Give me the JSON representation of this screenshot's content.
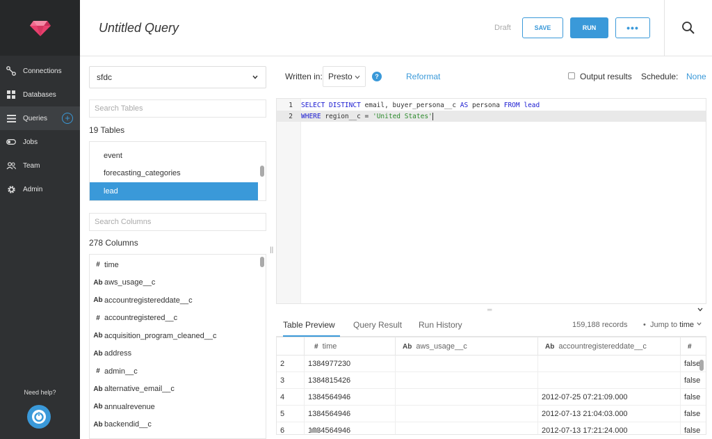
{
  "header": {
    "title": "Untitled Query",
    "draft": "Draft",
    "save_label": "SAVE",
    "run_label": "RUN",
    "more_label": "•••"
  },
  "sidebar": {
    "items": [
      {
        "label": "Connections",
        "icon": "connections-icon"
      },
      {
        "label": "Databases",
        "icon": "databases-icon"
      },
      {
        "label": "Queries",
        "icon": "queries-icon"
      },
      {
        "label": "Jobs",
        "icon": "jobs-icon"
      },
      {
        "label": "Team",
        "icon": "team-icon"
      },
      {
        "label": "Admin",
        "icon": "gear-icon"
      }
    ],
    "active": "Queries",
    "help_label": "Need help?"
  },
  "left": {
    "database": "sfdc",
    "search_tables_placeholder": "Search Tables",
    "tables_count": "19 Tables",
    "tables": [
      "event",
      "forecasting_categories",
      "lead"
    ],
    "selected_table": "lead",
    "search_columns_placeholder": "Search Columns",
    "columns_count": "278 Columns",
    "columns": [
      {
        "type": "#",
        "name": "time"
      },
      {
        "type": "Ab",
        "name": "aws_usage__c"
      },
      {
        "type": "Ab",
        "name": "accountregistereddate__c"
      },
      {
        "type": "#",
        "name": "accountregistered__c"
      },
      {
        "type": "Ab",
        "name": "acquisition_program_cleaned__c"
      },
      {
        "type": "Ab",
        "name": "address"
      },
      {
        "type": "#",
        "name": "admin__c"
      },
      {
        "type": "Ab",
        "name": "alternative_email__c"
      },
      {
        "type": "Ab",
        "name": "annualrevenue"
      },
      {
        "type": "Ab",
        "name": "backendid__c"
      }
    ]
  },
  "toolbar": {
    "written_in": "Written in:",
    "language": "Presto",
    "help": "?",
    "reformat": "Reformat",
    "output_results": "Output results",
    "schedule": "Schedule:",
    "schedule_value": "None"
  },
  "editor": {
    "lines": [
      {
        "num": "1",
        "kw1": "SELECT DISTINCT",
        "t1": " email, buyer_persona__c ",
        "kw2": "AS",
        "t2": " persona ",
        "kw3": "FROM",
        "t3": " ",
        "kw4": "lead"
      },
      {
        "num": "2",
        "kw1": "WHERE",
        "t1": " region__c = ",
        "str": "'United States'"
      }
    ]
  },
  "results": {
    "tabs": [
      "Table Preview",
      "Query Result",
      "Run History"
    ],
    "active_tab": "Table Preview",
    "records": "159,188 records",
    "bullet": "•",
    "jump_to": "Jump to",
    "jump_field": "time",
    "columns": [
      {
        "type": "#",
        "name": "time"
      },
      {
        "type": "Ab",
        "name": "aws_usage__c"
      },
      {
        "type": "Ab",
        "name": "accountregistereddate__c"
      },
      {
        "type": "#",
        "name": ""
      }
    ],
    "rows": [
      {
        "idx": "2",
        "time": "1384977230",
        "aws": "",
        "date": "",
        "reg": "false"
      },
      {
        "idx": "3",
        "time": "1384815426",
        "aws": "",
        "date": "",
        "reg": "false"
      },
      {
        "idx": "4",
        "time": "1384564946",
        "aws": "",
        "date": "2012-07-25 07:21:09.000",
        "reg": "false"
      },
      {
        "idx": "5",
        "time": "1384564946",
        "aws": "",
        "date": "2012-07-13 21:04:03.000",
        "reg": "false"
      },
      {
        "idx": "6",
        "time": "1384564946",
        "aws": "",
        "date": "2012-07-13 17:21:24.000",
        "reg": "false"
      }
    ]
  },
  "colors": {
    "accent": "#3a99d9",
    "sidebar": "#2f3133"
  }
}
